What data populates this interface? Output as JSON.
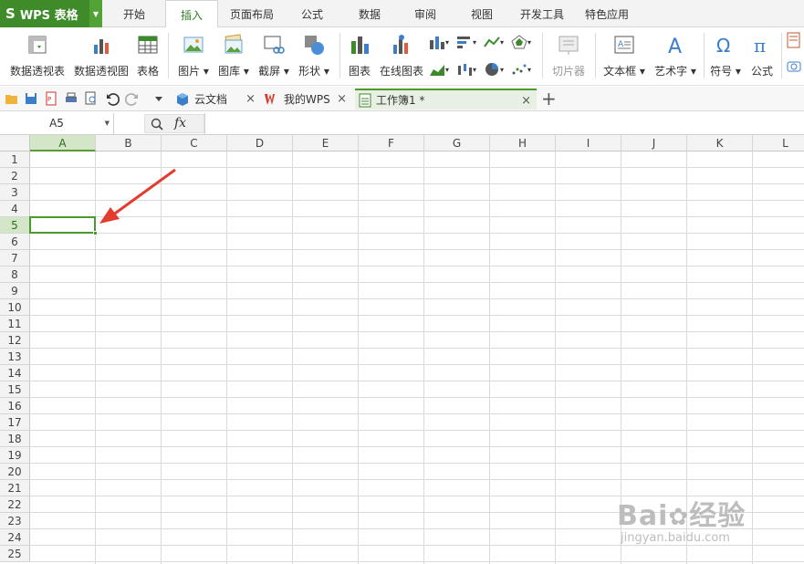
{
  "app": {
    "logo": "S",
    "name": "WPS 表格",
    "accent": "#3f8b2a"
  },
  "menu_tabs": [
    "开始",
    "插入",
    "页面布局",
    "公式",
    "数据",
    "审阅",
    "视图",
    "开发工具",
    "特色应用"
  ],
  "active_menu_tab": "插入",
  "ribbon": {
    "pivot_table": "数据透视表",
    "pivot_chart": "数据透视图",
    "table": "表格",
    "picture": "图片",
    "gallery": "图库",
    "screenshot": "截屏",
    "shapes": "形状",
    "chart": "图表",
    "online_chart": "在线图表",
    "slicer": "切片器",
    "textbox": "文本框",
    "wordart": "艺术字",
    "symbol": "符号",
    "formula": "公式"
  },
  "doc_tabs": [
    {
      "label": "云文档"
    },
    {
      "label": "我的WPS"
    },
    {
      "label": "工作簿1 *"
    }
  ],
  "new_tab_symbol": "+",
  "close_symbol": "×",
  "name_box": "A5",
  "fx_label": "fx",
  "columns": [
    "A",
    "B",
    "C",
    "D",
    "E",
    "F",
    "G",
    "H",
    "I",
    "J",
    "K",
    "L"
  ],
  "rows": [
    "1",
    "2",
    "3",
    "4",
    "5",
    "6",
    "7",
    "8",
    "9",
    "10",
    "11",
    "12",
    "13",
    "14",
    "15",
    "16",
    "17",
    "18",
    "19",
    "20",
    "21",
    "22",
    "23",
    "24",
    "25"
  ],
  "active_cell": "A5",
  "watermark": {
    "brand": "Bai",
    "brand_tail": "经验",
    "url": "jingyan.baidu.com"
  }
}
